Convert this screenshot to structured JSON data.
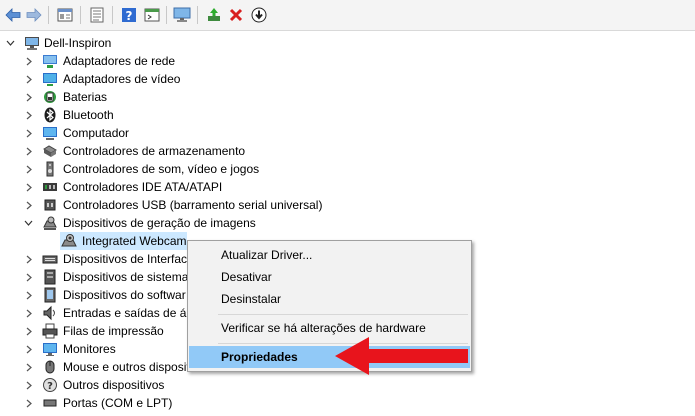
{
  "toolbar": {
    "buttons": [
      "back-icon",
      "forward-icon",
      "properties-icon",
      "list-icon",
      "help-icon",
      "console-icon",
      "monitor-scan-icon",
      "update-driver-icon",
      "uninstall-icon",
      "download-icon"
    ]
  },
  "tree": {
    "root": "Dell-Inspiron",
    "items": [
      {
        "label": "Adaptadores de rede",
        "icon": "network-adapter-icon"
      },
      {
        "label": "Adaptadores de vídeo",
        "icon": "display-adapter-icon"
      },
      {
        "label": "Baterias",
        "icon": "battery-icon"
      },
      {
        "label": "Bluetooth",
        "icon": "bluetooth-icon"
      },
      {
        "label": "Computador",
        "icon": "computer-icon"
      },
      {
        "label": "Controladores de armazenamento",
        "icon": "storage-controller-icon"
      },
      {
        "label": "Controladores de som, vídeo e jogos",
        "icon": "sound-icon"
      },
      {
        "label": "Controladores IDE ATA/ATAPI",
        "icon": "ide-icon"
      },
      {
        "label": "Controladores USB (barramento serial universal)",
        "icon": "usb-icon"
      },
      {
        "label": "Dispositivos de geração de imagens",
        "icon": "imaging-device-icon",
        "expanded": true
      },
      {
        "label": "Integrated Webcam",
        "icon": "webcam-icon",
        "child": true,
        "selected": true
      },
      {
        "label": "Dispositivos de Interfac",
        "icon": "hid-icon"
      },
      {
        "label": "Dispositivos de sistema",
        "icon": "system-device-icon"
      },
      {
        "label": "Dispositivos do softwar",
        "icon": "software-device-icon"
      },
      {
        "label": "Entradas e saídas de áu",
        "icon": "audio-io-icon"
      },
      {
        "label": "Filas de impressão",
        "icon": "print-queue-icon"
      },
      {
        "label": "Monitores",
        "icon": "monitor-icon"
      },
      {
        "label": "Mouse e outros dispositi",
        "icon": "mouse-icon"
      },
      {
        "label": "Outros dispositivos",
        "icon": "other-devices-icon"
      },
      {
        "label": "Portas (COM e LPT)",
        "icon": "ports-icon"
      }
    ]
  },
  "context_menu": {
    "items": [
      {
        "label": "Atualizar Driver..."
      },
      {
        "label": "Desativar"
      },
      {
        "label": "Desinstalar"
      },
      {
        "label": "Verificar se há alterações de hardware"
      },
      {
        "label": "Propriedades",
        "highlighted": true
      }
    ]
  },
  "colors": {
    "selection": "#cce8ff",
    "menu_highlight": "#91c9f7",
    "arrow": "#e8141c"
  }
}
